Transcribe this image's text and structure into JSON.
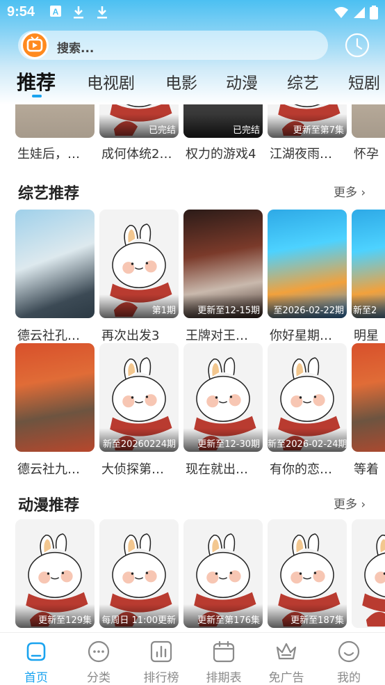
{
  "status_bar": {
    "time": "9:54"
  },
  "search": {
    "placeholder": "搜索..."
  },
  "tabs": [
    {
      "label": "推荐",
      "active": true
    },
    {
      "label": "电视剧"
    },
    {
      "label": "电影"
    },
    {
      "label": "动漫"
    },
    {
      "label": "综艺"
    },
    {
      "label": "短剧"
    }
  ],
  "top_row": [
    {
      "title": "生娃后，…",
      "badge": ""
    },
    {
      "title": "成何体统2…",
      "badge": "已完结"
    },
    {
      "title": "权力的游戏4",
      "badge": "已完结"
    },
    {
      "title": "江湖夜雨…",
      "badge": "更新至第7集"
    },
    {
      "title": "怀孕",
      "badge": ""
    }
  ],
  "variety": {
    "title": "综艺推荐",
    "more": "更多",
    "row1": [
      {
        "title": "德云社孔…",
        "badge": ""
      },
      {
        "title": "再次出发3",
        "badge": "第1期"
      },
      {
        "title": "王牌对王…",
        "badge": "更新至12-15期"
      },
      {
        "title": "你好星期…",
        "badge": "至2026-02-22期"
      },
      {
        "title": "明星",
        "badge": "新至2"
      }
    ],
    "row2": [
      {
        "title": "德云社九…",
        "badge": ""
      },
      {
        "title": "大侦探第…",
        "badge": "新至20260224期"
      },
      {
        "title": "现在就出…",
        "badge": "更新至12-30期"
      },
      {
        "title": "有你的恋…",
        "badge": "新至2026-02-24期"
      },
      {
        "title": "等着",
        "badge": ""
      }
    ]
  },
  "anime": {
    "title": "动漫推荐",
    "more": "更多",
    "row1": [
      {
        "badge": "更新至129集"
      },
      {
        "badge": "每周日 11:00更新"
      },
      {
        "badge": "更新至第176集"
      },
      {
        "badge": "更新至187集"
      },
      {
        "badge": ""
      }
    ]
  },
  "bottom_nav": [
    {
      "label": "首页",
      "icon": "home-icon",
      "active": true
    },
    {
      "label": "分类",
      "icon": "category-icon"
    },
    {
      "label": "排行榜",
      "icon": "ranking-icon"
    },
    {
      "label": "排期表",
      "icon": "schedule-icon"
    },
    {
      "label": "免广告",
      "icon": "crown-icon"
    },
    {
      "label": "我的",
      "icon": "profile-icon"
    }
  ],
  "colors": {
    "accent": "#1aa3ef",
    "header_top": "#4cc0f2",
    "logo": "#ff8a1f"
  }
}
